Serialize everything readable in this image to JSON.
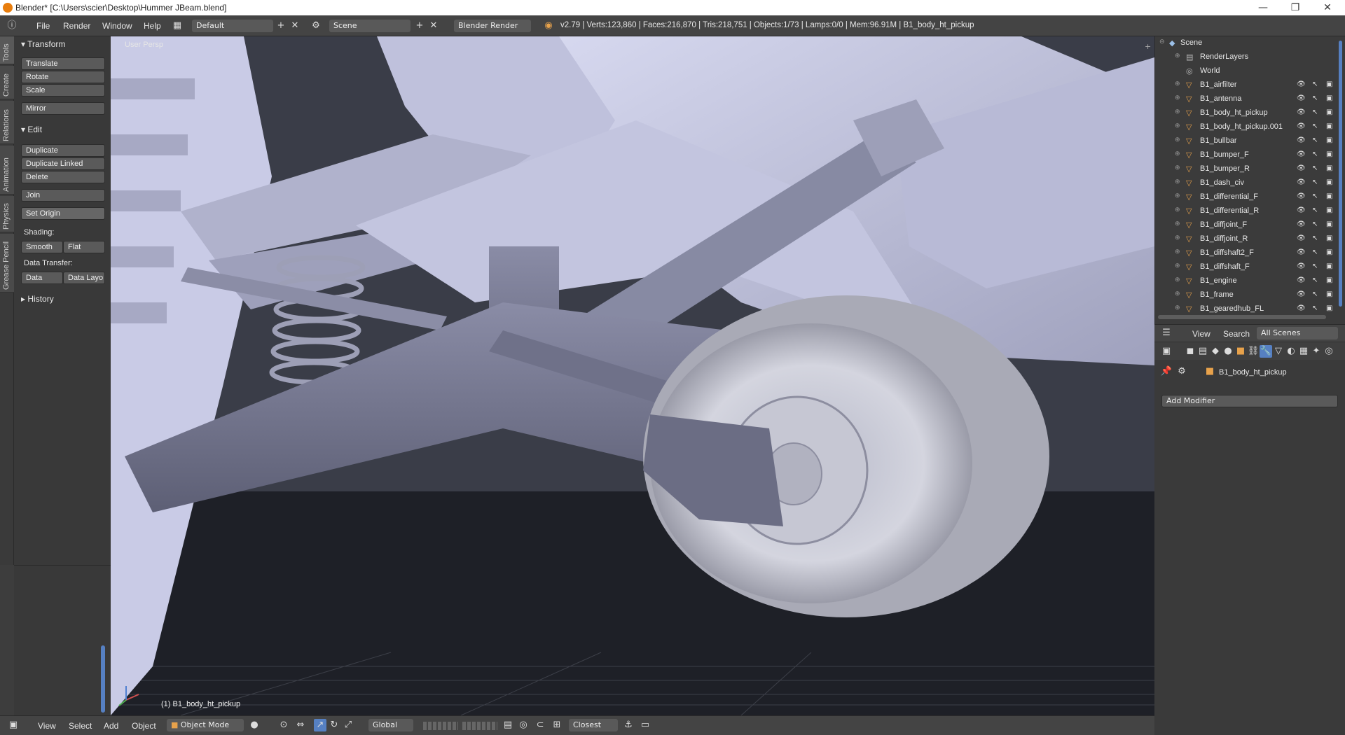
{
  "window": {
    "title": "Blender* [C:\\Users\\scier\\Desktop\\Hummer JBeam.blend]",
    "controls": [
      "—",
      "❐",
      "✕"
    ]
  },
  "topbar": {
    "menus": [
      "File",
      "Render",
      "Window",
      "Help"
    ],
    "layout": "Default",
    "scene": "Scene",
    "engine": "Blender Render",
    "stats": "v2.79 | Verts:123,860 | Faces:216,870 | Tris:218,751 | Objects:1/73 | Lamps:0/0 | Mem:96.91M | B1_body_ht_pickup"
  },
  "left_tabs": [
    "Tools",
    "Create",
    "Relations",
    "Animation",
    "Physics",
    "Grease Pencil"
  ],
  "toolshelf": {
    "transform_header": "Transform",
    "translate": "Translate",
    "rotate": "Rotate",
    "scale": "Scale",
    "mirror": "Mirror",
    "edit_header": "Edit",
    "duplicate": "Duplicate",
    "duplicate_linked": "Duplicate Linked",
    "delete": "Delete",
    "join": "Join",
    "set_origin": "Set Origin",
    "shading_label": "Shading:",
    "smooth": "Smooth",
    "flat": "Flat",
    "data_transfer_label": "Data Transfer:",
    "data": "Data",
    "data_layout": "Data Layo",
    "history_header": "History"
  },
  "viewport": {
    "view_label": "User Persp",
    "object_label": "(1) B1_body_ht_pickup"
  },
  "bottombar": {
    "view": "View",
    "select": "Select",
    "add": "Add",
    "object": "Object",
    "mode": "Object Mode",
    "orientation": "Global",
    "snap": "Closest"
  },
  "outliner": {
    "scene": "Scene",
    "render_layers": "RenderLayers",
    "world": "World",
    "objects": [
      "B1_airfilter",
      "B1_antenna",
      "B1_body_ht_pickup",
      "B1_body_ht_pickup.001",
      "B1_bullbar",
      "B1_bumper_F",
      "B1_bumper_R",
      "B1_dash_civ",
      "B1_differential_F",
      "B1_differential_R",
      "B1_diffjoint_F",
      "B1_diffjoint_R",
      "B1_diffshaft2_F",
      "B1_diffshaft_F",
      "B1_engine",
      "B1_frame",
      "B1_gearedhub_FL"
    ],
    "header": {
      "view": "View",
      "search": "Search",
      "filter": "All Scenes"
    }
  },
  "properties": {
    "object_name": "B1_body_ht_pickup",
    "add_modifier": "Add Modifier"
  },
  "colors": {
    "accent": "#5680c2",
    "viewport_bg": "#3a3d48",
    "panel": "#393939",
    "mesh": "#c9cbe6"
  }
}
